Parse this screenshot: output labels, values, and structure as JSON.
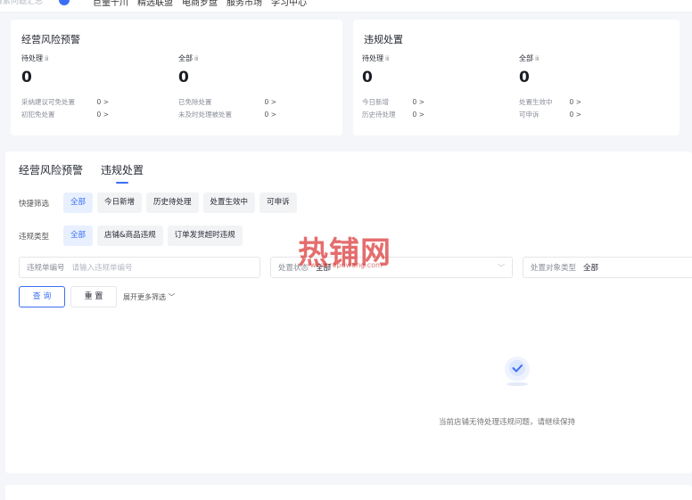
{
  "topbar": {
    "search_placeholder": "搜索问题汇总",
    "nav": [
      "巨量千川",
      "精选联盟",
      "电商罗盘",
      "服务市场",
      "学习中心"
    ]
  },
  "risk_card": {
    "title": "经营风险预警",
    "pending_label": "待处理",
    "pending_value": "0",
    "all_label": "全部",
    "all_value": "0",
    "rows_left": [
      {
        "label": "采纳建议可免处置",
        "value": "0 >"
      },
      {
        "label": "初犯免处置",
        "value": "0 >"
      }
    ],
    "rows_right": [
      {
        "label": "已免除处置",
        "value": "0 >"
      },
      {
        "label": "未及时处理被处置",
        "value": "0 >"
      }
    ]
  },
  "violation_card": {
    "title": "违规处置",
    "pending_label": "待处理",
    "pending_value": "0",
    "all_label": "全部",
    "all_value": "0",
    "rows_left": [
      {
        "label": "今日新增",
        "value": "0 >"
      },
      {
        "label": "历史待处理",
        "value": "0 >"
      }
    ],
    "rows_right": [
      {
        "label": "处置生效中",
        "value": "0 >"
      },
      {
        "label": "可申诉",
        "value": "0 >"
      }
    ]
  },
  "tabs": [
    "经营风险预警",
    "违规处置"
  ],
  "quick_filter": {
    "label": "快捷筛选",
    "chips": [
      "全部",
      "今日新增",
      "历史待处理",
      "处置生效中",
      "可申诉"
    ]
  },
  "violation_type": {
    "label": "违规类型",
    "chips": [
      "全部",
      "店铺&商品违规",
      "订单发货超时违规"
    ]
  },
  "fields": {
    "ticket_label": "违规单编号",
    "ticket_placeholder": "请输入违规单编号",
    "status_label": "处置状态",
    "status_value": "全部",
    "target_label": "处置对象类型",
    "target_value": "全部"
  },
  "buttons": {
    "query": "查 询",
    "reset": "重 置",
    "expand": "展开更多筛选"
  },
  "empty_text": "当前店铺无待处理违规问题，请继续保持",
  "watermark": {
    "text": "热铺网",
    "sub": "www.repuwang.com"
  },
  "colors": {
    "accent": "#3b6ef5",
    "selected_bg": "#e8f0ff",
    "chip_bg": "#f2f3f5"
  }
}
